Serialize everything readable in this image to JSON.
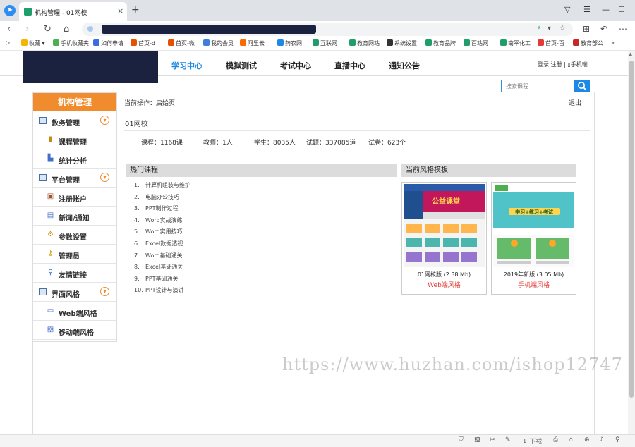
{
  "browser": {
    "tab_title": "机构管理 - 01网校",
    "new_tab": "+",
    "close_tab": "×",
    "bookmarks": [
      "收藏",
      "手机收藏夹",
      "如何申请",
      "首页-d",
      "首页-微",
      "我的会员",
      "阿里云",
      "药农网",
      "互联网",
      "教育网站",
      "系统设置",
      "教育品牌",
      "百站网",
      "南平化工",
      "首页-百",
      "教育部公"
    ],
    "bookmarks_more": "»",
    "download_label": "下载"
  },
  "header": {
    "nav": [
      "学习中心",
      "模拟测试",
      "考试中心",
      "直播中心",
      "通知公告"
    ],
    "login": "登录",
    "register": "注册",
    "separator": "|",
    "mobile": "手机端"
  },
  "search": {
    "placeholder": "搜索课程"
  },
  "sidebar": {
    "title": "机构管理",
    "groups": [
      {
        "label": "教务管理",
        "items": [
          "课程管理",
          "统计分析"
        ]
      },
      {
        "label": "平台管理",
        "items": [
          "注册账户",
          "新闻/通知",
          "参数设置",
          "管理员",
          "友情链接"
        ]
      },
      {
        "label": "界面风格",
        "items": [
          "Web端风格",
          "移动端风格"
        ]
      }
    ]
  },
  "main": {
    "breadcrumb": "当前操作：启始页",
    "logout": "退出",
    "school_name": "01网校",
    "stats": {
      "courses": "课程：1168课",
      "teachers": "教师：1人",
      "students": "学生：8035人",
      "questions": "试题：337085道",
      "papers": "试卷：623个"
    },
    "hot_courses_title": "热门课程",
    "hot_courses": [
      "计算机组装与维护",
      "电脑办公技巧",
      "PPT制作过程",
      "Word实战演练",
      "Word实用技巧",
      "Excel数据透视",
      "Word基础通关",
      "Excel基础通关",
      "PPT基础通关",
      "PPT设计与演讲"
    ],
    "templates_title": "当前风格模板",
    "templates": [
      {
        "name": "01网校版",
        "size": "(2.38 Mb)",
        "type": "Web端风格",
        "banner": "公益课堂"
      },
      {
        "name": "2019年新版",
        "size": "(3.05 Mb)",
        "type": "手机端风格",
        "banner": "学习+练习+考试"
      }
    ]
  },
  "watermark": "https://www.huzhan.com/ishop12747",
  "colors": {
    "accent": "#1e88e5",
    "sidebar_title": "#f08c2d",
    "template_type": "#e53935"
  }
}
